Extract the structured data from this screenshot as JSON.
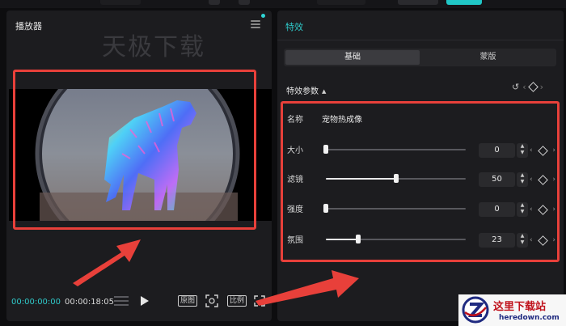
{
  "player": {
    "title": "播放器",
    "watermark": "天极下载",
    "time_current": "00:00:00:00",
    "time_total": "00:00:18:05",
    "btn_original": "原图",
    "btn_ratio": "比例"
  },
  "effects": {
    "panel_title": "特效",
    "tabs": [
      "基础",
      "蒙版"
    ],
    "section_title": "特效参数",
    "name_label": "名称",
    "name_value": "宠物热成像",
    "params": [
      {
        "label": "大小",
        "value": "0",
        "level": 0
      },
      {
        "label": "滤镜",
        "value": "50",
        "level": 50
      },
      {
        "label": "强度",
        "value": "0",
        "level": 0
      },
      {
        "label": "氛围",
        "value": "23",
        "level": 23
      }
    ]
  },
  "logo": {
    "cn": "这里下载站",
    "en": "heredown.com"
  },
  "colors": {
    "accent": "#2fc9c9",
    "highlight": "#e8403a",
    "panel": "#1c1c1f"
  }
}
